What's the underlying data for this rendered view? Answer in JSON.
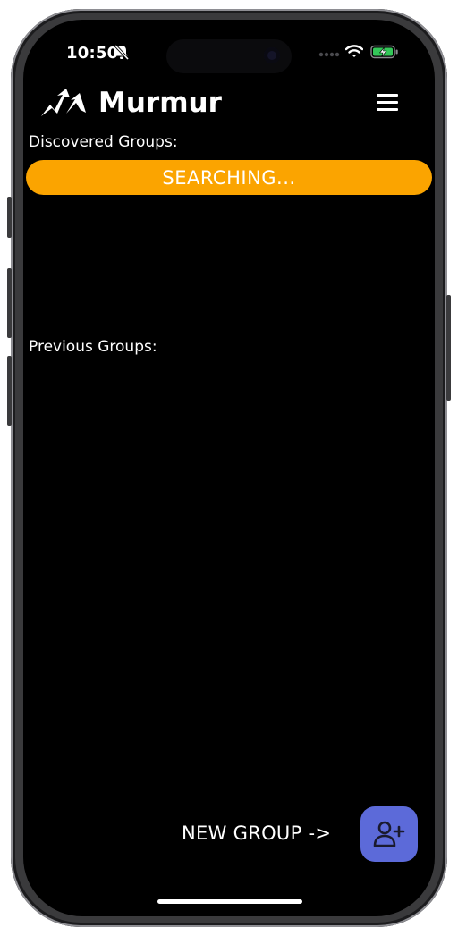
{
  "status_bar": {
    "time": "10:50",
    "icons": [
      "bell-slash-icon",
      "cellular-signal-icon",
      "wifi-icon",
      "battery-charging-icon"
    ]
  },
  "header": {
    "title": "Murmur",
    "logo": "murmur-birds-logo",
    "menu_icon": "hamburger-menu-icon"
  },
  "discovered": {
    "label": "Discovered Groups:",
    "status": "SEARCHING..."
  },
  "previous": {
    "label": "Previous Groups:"
  },
  "new_group": {
    "label": "NEW GROUP ->",
    "icon": "person-add-icon"
  },
  "colors": {
    "background": "#000000",
    "searching_bar": "#fba400",
    "fab": "#5c6ad9",
    "text": "#ffffff"
  }
}
